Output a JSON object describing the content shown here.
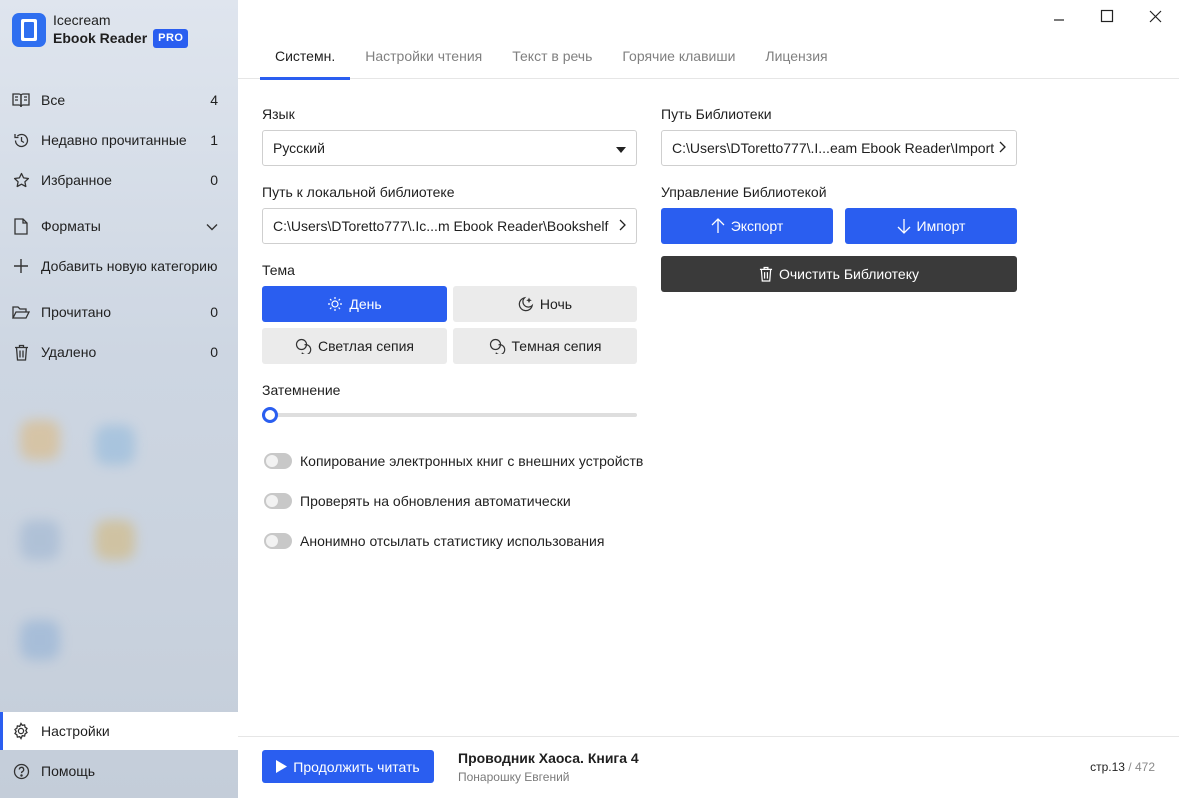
{
  "app": {
    "name_line1": "Icecream",
    "name_line2": "Ebook Reader",
    "badge": "PRO"
  },
  "sidebar": {
    "items": [
      {
        "label": "Все",
        "count": "4",
        "icon": "book-open-icon"
      },
      {
        "label": "Недавно прочитанные",
        "count": "1",
        "icon": "history-icon"
      },
      {
        "label": "Избранное",
        "count": "0",
        "icon": "star-icon"
      },
      {
        "label": "Форматы",
        "icon": "file-icon"
      },
      {
        "label": "Добавить новую категорию",
        "icon": "plus-icon"
      },
      {
        "label": "Прочитано",
        "count": "0",
        "icon": "folder-open-icon"
      },
      {
        "label": "Удалено",
        "count": "0",
        "icon": "trash-icon"
      }
    ],
    "bottom": [
      {
        "label": "Настройки",
        "icon": "gear-icon",
        "active": true
      },
      {
        "label": "Помощь",
        "icon": "help-icon"
      }
    ]
  },
  "tabs": [
    {
      "label": "Системн.",
      "active": true
    },
    {
      "label": "Настройки чтения"
    },
    {
      "label": "Текст в речь"
    },
    {
      "label": "Горячие клавиши"
    },
    {
      "label": "Лицензия"
    }
  ],
  "settings": {
    "language_label": "Язык",
    "language_value": "Русский",
    "local_library_label": "Путь к локальной библиотеке",
    "local_library_value": "C:\\Users\\DToretto777\\.Ic...m Ebook Reader\\Bookshelf",
    "theme_label": "Тема",
    "themes": {
      "day": "День",
      "night": "Ночь",
      "light_sepia": "Светлая сепия",
      "dark_sepia": "Темная сепия"
    },
    "dimming_label": "Затемнение",
    "dimming_value": 0,
    "toggles": [
      {
        "label": "Копирование электронных книг с внешних устройств",
        "on": false
      },
      {
        "label": "Проверять на обновления автоматически",
        "on": false
      },
      {
        "label": "Анонимно отсылать статистику использования",
        "on": false
      }
    ],
    "library_path_label": "Путь Библиотеки",
    "library_path_value": "C:\\Users\\DToretto777\\.I...eam Ebook Reader\\Import",
    "library_manage_label": "Управление Библиотекой",
    "export_label": "Экспорт",
    "import_label": "Импорт",
    "clear_label": "Очистить Библиотеку"
  },
  "footer": {
    "continue_label": "Продолжить читать",
    "book_title": "Проводник Хаоса. Книга 4",
    "book_author": "Понарошку Евгений",
    "page_prefix": "стр.",
    "page_current": "13",
    "page_total": "/ 472"
  },
  "colors": {
    "accent": "#2a5ef0",
    "dark_button": "#3a3a3a",
    "light_button": "#ebebeb"
  }
}
